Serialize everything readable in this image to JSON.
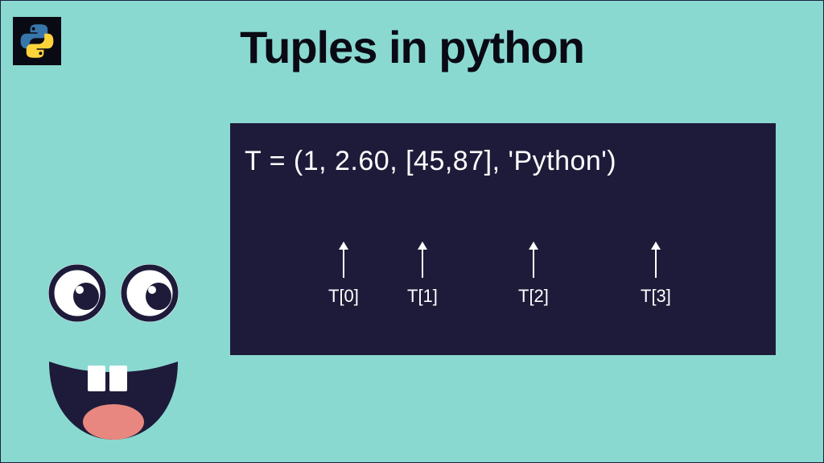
{
  "title": "Tuples in python",
  "logo": {
    "name": "python-logo"
  },
  "code": {
    "expression": "T = (1,  2.60,  [45,87],  'Python')",
    "indexes": [
      "T[0]",
      "T[1]",
      "T[2]",
      "T[3]"
    ]
  },
  "colors": {
    "background": "#8AD9D1",
    "panel": "#1e1b3a",
    "title": "#0a0a14"
  }
}
